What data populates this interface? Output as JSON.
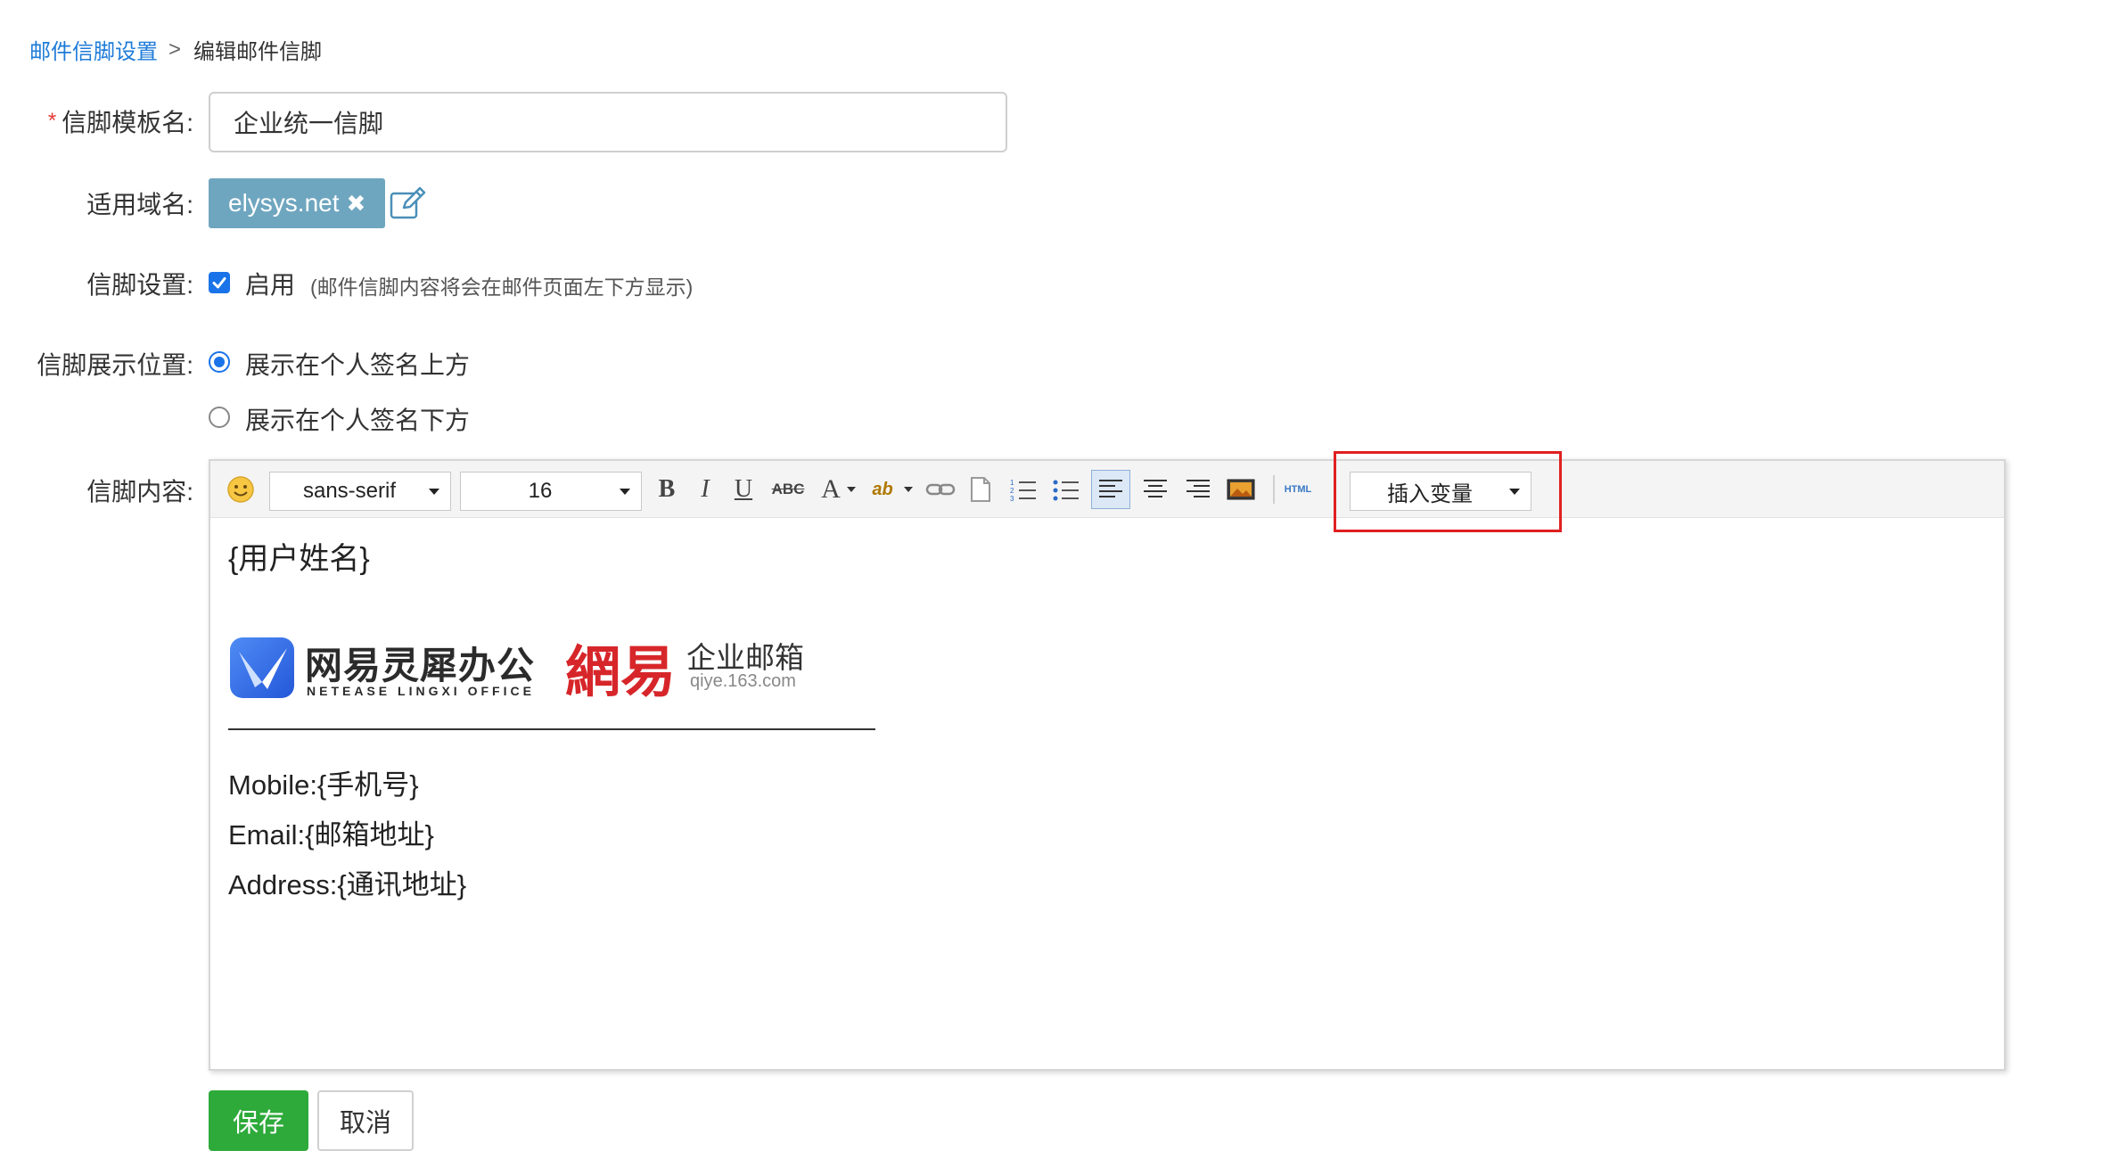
{
  "breadcrumb": {
    "parent": "邮件信脚设置",
    "separator": ">",
    "current": "编辑邮件信脚"
  },
  "form": {
    "template_name": {
      "required_mark": "*",
      "label": "信脚模板名:",
      "value": "企业统一信脚"
    },
    "domain": {
      "label": "适用域名:",
      "tag": "elysys.net",
      "remove_glyph": "✖",
      "edit_icon": "edit-icon"
    },
    "footer_setting": {
      "label": "信脚设置:",
      "checked": true,
      "checkbox_label": "启用",
      "hint": "(邮件信脚内容将会在邮件页面左下方显示)"
    },
    "position": {
      "label": "信脚展示位置:",
      "options": [
        {
          "label": "展示在个人签名上方",
          "selected": true
        },
        {
          "label": "展示在个人签名下方",
          "selected": false
        }
      ]
    },
    "content": {
      "label": "信脚内容:"
    }
  },
  "editor": {
    "toolbar": {
      "emoji_icon": "emoji-icon",
      "font_family": "sans-serif",
      "font_size": "16",
      "bold": "B",
      "italic": "I",
      "underline": "U",
      "strike": "ABC",
      "font_color": "A",
      "highlight": "ab",
      "html_label": "HTML",
      "insert_variable": "插入变量"
    },
    "body": {
      "user_name_var": "{用户姓名}",
      "logo_left": {
        "title": "网易灵犀办公",
        "subtitle": "NETEASE LINGXI OFFICE"
      },
      "logo_right": {
        "brand": "網易",
        "title": "企业邮箱",
        "subtitle": "qiye.163.com"
      },
      "lines": [
        "Mobile:{手机号}",
        "Email:{邮箱地址}",
        "Address:{通讯地址}"
      ]
    }
  },
  "actions": {
    "save": "保存",
    "cancel": "取消"
  },
  "colors": {
    "link": "#1e7bd8",
    "tag_bg": "#6fa6bf",
    "primary": "#1a73e8",
    "save_bg": "#2eaa3a",
    "highlight_border": "#e02020",
    "brand_red": "#d7262a",
    "lingxi_blue": "#2e63e0"
  }
}
